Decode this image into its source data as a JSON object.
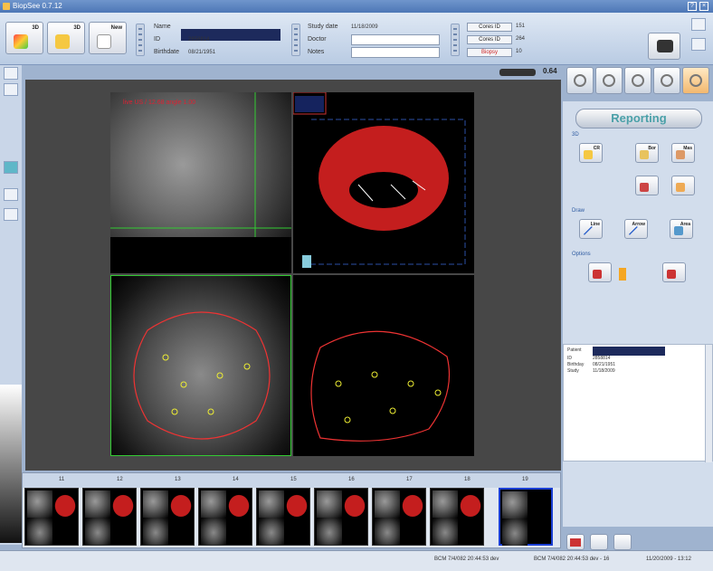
{
  "window": {
    "title": "BiopSee 0.7.12"
  },
  "toolbar": {
    "buttons": [
      {
        "label": "3D"
      },
      {
        "label": "3D"
      },
      {
        "label": "New"
      }
    ]
  },
  "patient": {
    "name_label": "Name",
    "id_label": "ID",
    "id_value": "2858814",
    "birthdate_label": "Birthdate",
    "birthdate_value": "08/21/1951"
  },
  "study": {
    "date_label": "Study date",
    "date_value": "11/18/2009",
    "doctor_label": "Doctor",
    "notes_label": "Notes"
  },
  "counters": [
    {
      "label": "Cores ID",
      "value": "151"
    },
    {
      "label": "Cores ID",
      "value": "264"
    },
    {
      "label": "Biopsy",
      "value": "10"
    }
  ],
  "viewer": {
    "zoom": "0.64",
    "overlay_text": "live US / 12.68 angle 1.00"
  },
  "right_panel": {
    "title": "Reporting",
    "sections": {
      "d3": "3D",
      "draw": "Draw",
      "options": "Options"
    },
    "buttons_3d": [
      "CR",
      "Bor",
      "Mas",
      "",
      ""
    ],
    "buttons_draw": [
      "Line",
      "Arrow",
      "Area"
    ],
    "info": {
      "patient_label": "Patient",
      "id_label": "ID",
      "id_value": "2858814",
      "birthday_label": "Birthday",
      "birthday_value": "08/21/1951",
      "study_label": "Study",
      "study_value": "11/18/2009"
    }
  },
  "thumbnails": {
    "labels": [
      "11",
      "12",
      "13",
      "14",
      "15",
      "16",
      "17",
      "18",
      "19"
    ]
  },
  "status": {
    "items": [
      "BCM 7/4/082 20:44:53 dev",
      "BCM 7/4/082 20:44:53 dev - 16",
      "11/20/2009 - 13:12"
    ]
  },
  "colors": {
    "prostate_red": "#c41e1e",
    "title_blue": "#1d2a5c",
    "reporting_text": "#4aa0a8"
  },
  "icons": [
    "camera-icon",
    "probe-icon",
    "needle-icon",
    "organ-icon",
    "report-icon"
  ]
}
